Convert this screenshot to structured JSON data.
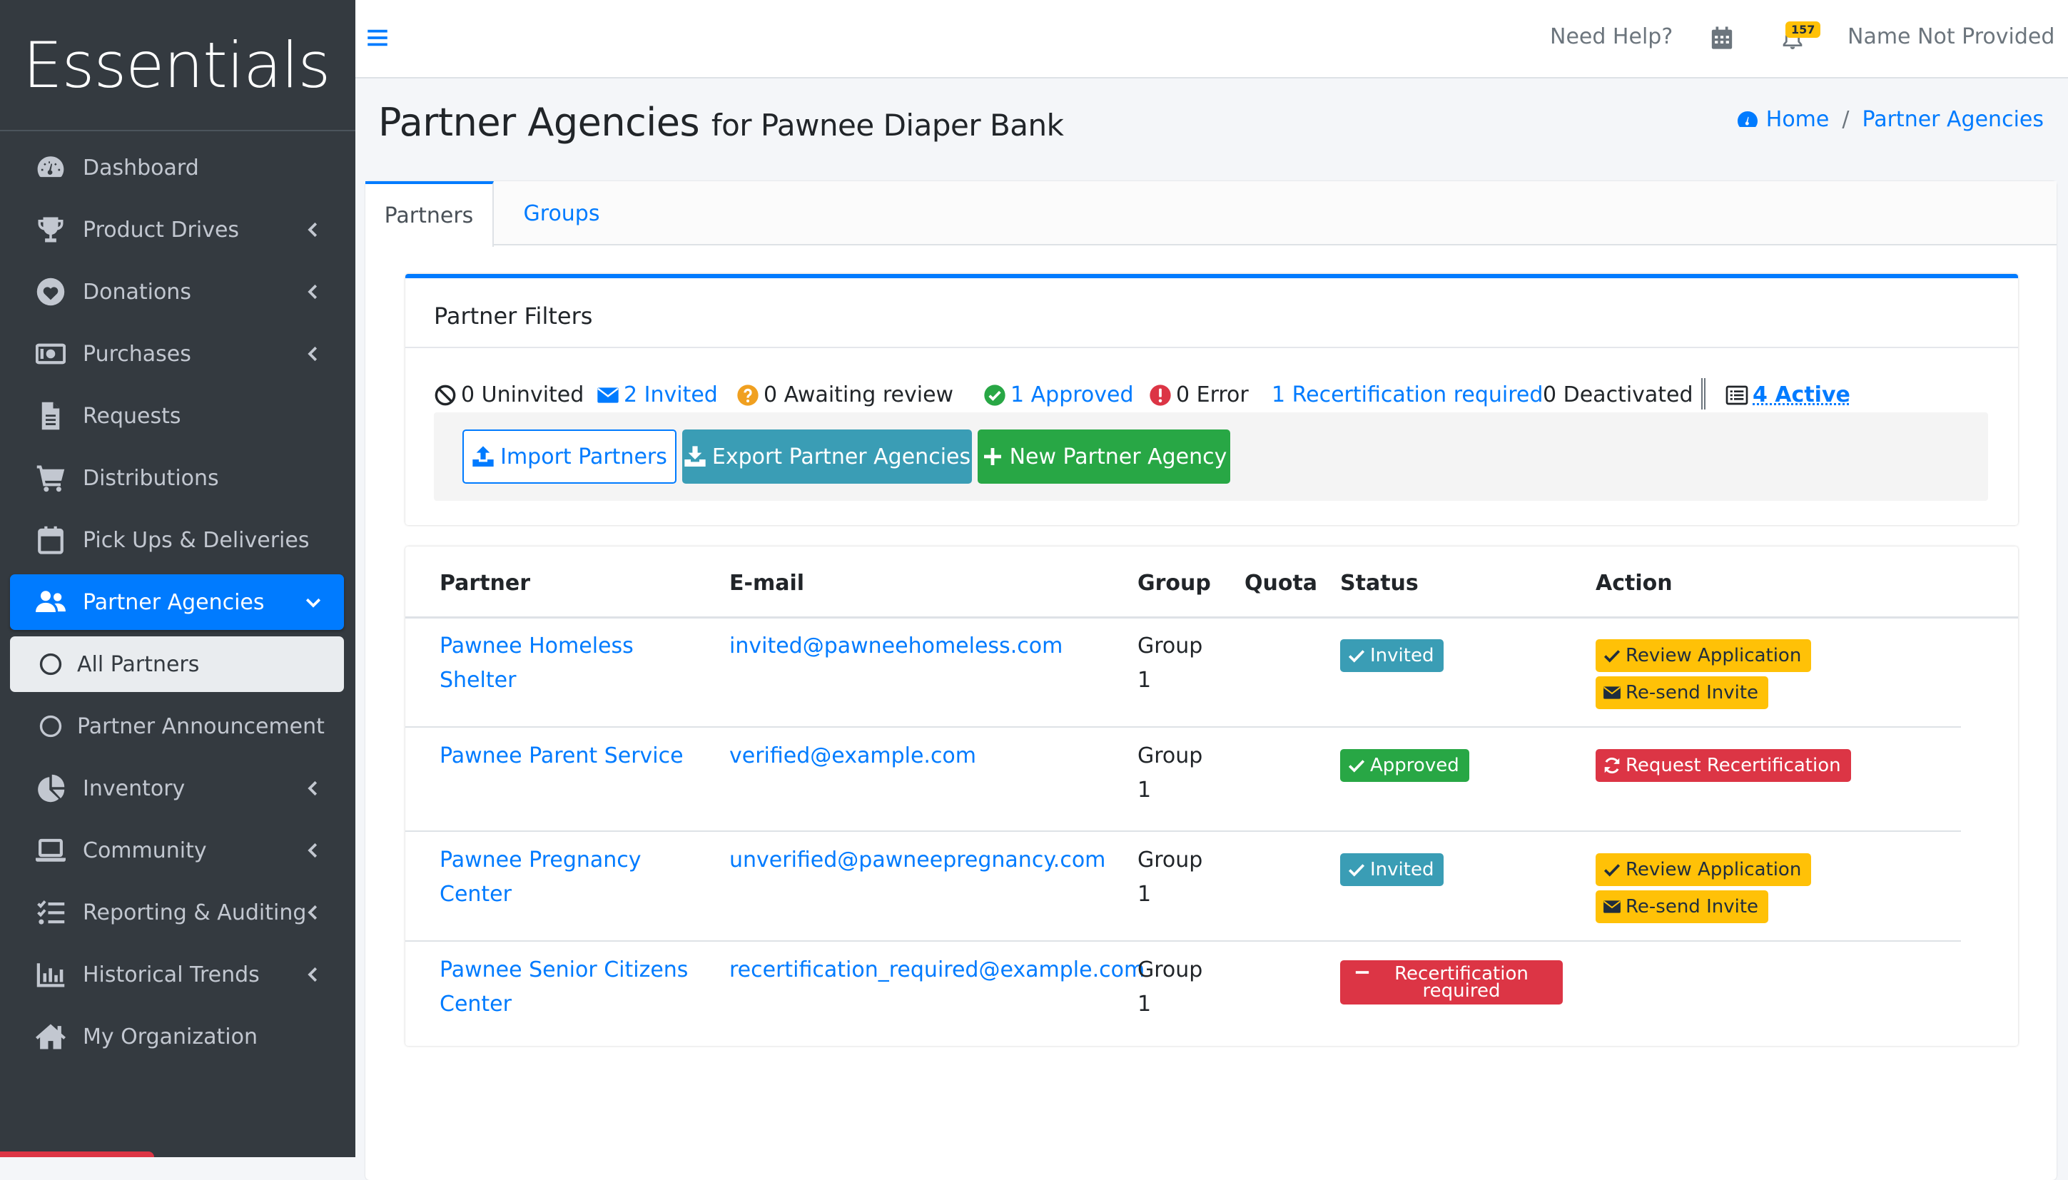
{
  "brand": {
    "name": "Essentials"
  },
  "sidebar": {
    "items": [
      {
        "label": "Dashboard",
        "icon": "dashboard-gauge-icon",
        "expandable": false
      },
      {
        "label": "Product Drives",
        "icon": "trophy-icon",
        "expandable": true
      },
      {
        "label": "Donations",
        "icon": "heart-icon",
        "expandable": true
      },
      {
        "label": "Purchases",
        "icon": "money-bill-icon",
        "expandable": true
      },
      {
        "label": "Requests",
        "icon": "file-icon",
        "expandable": false
      },
      {
        "label": "Distributions",
        "icon": "cart-icon",
        "expandable": false
      },
      {
        "label": "Pick Ups & Deliveries",
        "icon": "calendar-icon",
        "expandable": false
      },
      {
        "label": "Partner Agencies",
        "icon": "users-icon",
        "expandable": true,
        "active": true
      },
      {
        "label": "All Partners",
        "icon": "circle-outline-icon",
        "sub": true,
        "active": true
      },
      {
        "label": "Partner Announcement",
        "icon": "circle-outline-icon",
        "sub": true
      },
      {
        "label": "Inventory",
        "icon": "pie-chart-icon",
        "expandable": true
      },
      {
        "label": "Community",
        "icon": "laptop-icon",
        "expandable": true
      },
      {
        "label": "Reporting & Auditing",
        "icon": "list-check-icon",
        "expandable": true
      },
      {
        "label": "Historical Trends",
        "icon": "bar-chart-icon",
        "expandable": true
      },
      {
        "label": "My Organization",
        "icon": "home-icon",
        "expandable": false
      }
    ]
  },
  "navbar": {
    "help": "Need Help?",
    "notification_count": "157",
    "user": "Name Not Provided"
  },
  "header": {
    "title": "Partner Agencies",
    "subtitle": "for Pawnee Diaper Bank",
    "breadcrumb": {
      "home": "Home",
      "current": "Partner Agencies"
    }
  },
  "tabs": [
    {
      "label": "Partners",
      "active": true
    },
    {
      "label": "Groups",
      "active": false
    }
  ],
  "filters": {
    "title": "Partner Filters",
    "items": [
      {
        "label": "0 Uninvited",
        "link": false,
        "icon": "ban-icon"
      },
      {
        "label": "2 Invited",
        "link": true,
        "icon": "envelope-icon"
      },
      {
        "label": "0 Awaiting review",
        "link": false,
        "icon": "question-circle-icon"
      },
      {
        "label": "1 Approved",
        "link": true,
        "icon": "check-circle-icon"
      },
      {
        "label": "0 Error",
        "link": false,
        "icon": "exclamation-circle-icon"
      },
      {
        "label": "1 Recertification required",
        "link": true,
        "icon": ""
      },
      {
        "label": "0 Deactivated",
        "link": false,
        "icon": ""
      }
    ],
    "active_label": "4 Active",
    "buttons": {
      "import": "Import Partners",
      "export": "Export Partner Agencies",
      "new": "New Partner Agency"
    }
  },
  "table": {
    "columns": [
      "Partner",
      "E-mail",
      "Group",
      "Quota",
      "Status",
      "Action"
    ],
    "rows": [
      {
        "partner": "Pawnee Homeless Shelter",
        "email": "invited@pawneehomeless.com",
        "group": "Group 1",
        "quota": "",
        "status": "Invited",
        "actions": [
          "Review Application",
          "Re-send Invite"
        ]
      },
      {
        "partner": "Pawnee Parent Service",
        "email": "verified@example.com",
        "group": "Group 1",
        "quota": "",
        "status": "Approved",
        "actions": [
          "Request Recertification"
        ]
      },
      {
        "partner": "Pawnee Pregnancy Center",
        "email": "unverified@pawneepregnancy.com",
        "group": "Group 1",
        "quota": "",
        "status": "Invited",
        "actions": [
          "Review Application",
          "Re-send Invite"
        ]
      },
      {
        "partner": "Pawnee Senior Citizens Center",
        "email": "recertification_required@example.com",
        "group": "Group 1",
        "quota": "",
        "status": "Recertification required",
        "actions": []
      }
    ]
  },
  "colors": {
    "primary": "#007bff",
    "sidebar_bg": "#343a40",
    "info": "#3a9db5",
    "success": "#28a745",
    "warning": "#ffc107",
    "danger": "#dc3545"
  }
}
